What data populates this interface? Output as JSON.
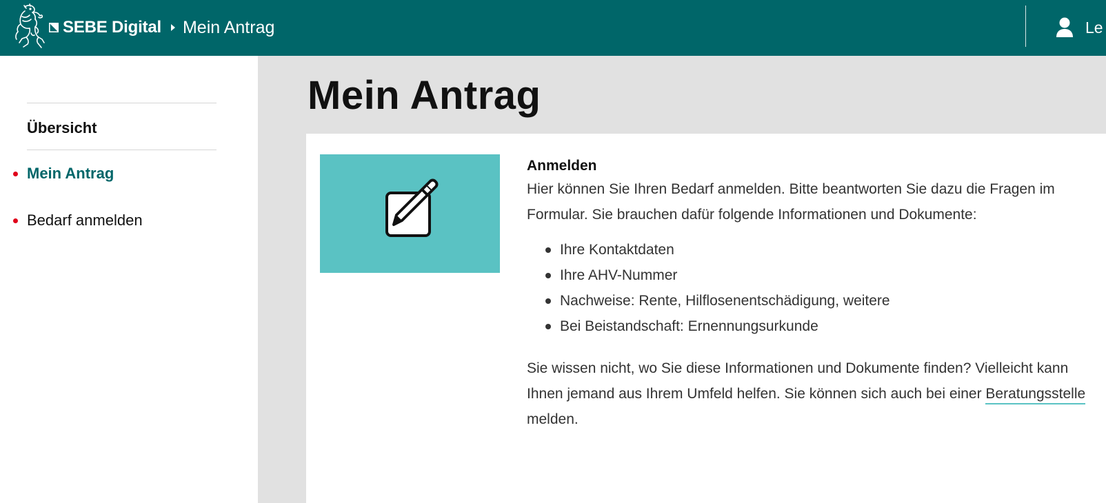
{
  "header": {
    "logo_icon": "bear-crest-logo",
    "brand": "SEBE Digital",
    "breadcrumb_current": "Mein Antrag",
    "user_icon": "user-icon",
    "user_label": "Le"
  },
  "sidebar": {
    "heading": "Übersicht",
    "items": [
      {
        "label": "Mein Antrag",
        "active": true
      },
      {
        "label": "Bedarf anmelden",
        "active": false
      }
    ]
  },
  "main": {
    "title": "Mein Antrag",
    "card": {
      "image_icon": "edit-pencil-icon",
      "heading": "Anmelden",
      "intro": "Hier können Sie Ihren Bedarf anmelden. Bitte beantworten Sie dazu die Fragen im Formular. Sie brauchen dafür folgende Informationen und Dokumente:",
      "list": [
        "Ihre Kontaktdaten",
        "Ihre AHV-Nummer",
        "Nachweise: Rente, Hilflosenentschädigung, weitere",
        "Bei Beistandschaft: Ernennungsurkunde"
      ],
      "help_before": "Sie wissen nicht, wo Sie diese Informationen und Dokumente finden? Vielleicht kann Ihnen jemand aus Ihrem Umfeld helfen. Sie können sich auch bei einer ",
      "help_link": "Beratungsstelle",
      "help_after": " melden."
    }
  },
  "colors": {
    "header_bg": "#006669",
    "accent_teal": "#5ac2c3",
    "nav_dot": "#e0001a",
    "main_bg": "#e1e1e1"
  }
}
